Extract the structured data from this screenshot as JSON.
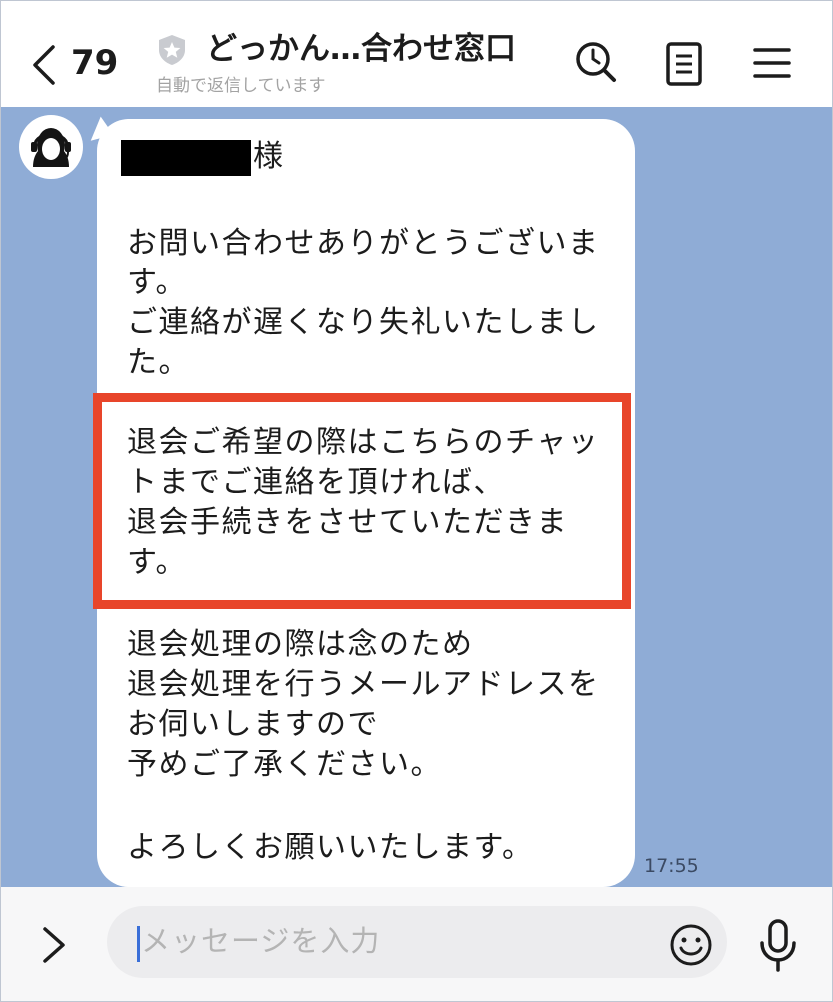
{
  "header": {
    "back_count": "79",
    "title": "どっかん…合わせ窓口",
    "status": "自動で返信しています",
    "icons": [
      "back-chevron-icon",
      "shield-star-icon",
      "search-icon",
      "notes-icon",
      "menu-icon"
    ]
  },
  "message": {
    "recipient_suffix": "様",
    "lines": [
      "お問い合わせありがとうございま",
      "す。",
      "ご連絡が遅くなり失礼いたしまし",
      "た。",
      "退会ご希望の際はこちらのチャッ",
      "トまでご連絡を頂ければ、",
      "退会手続きをさせていただきま",
      "す。",
      "退会処理の際は念のため",
      "退会処理を行うメールアドレスを",
      "お伺いしますので",
      "予めご了承ください。",
      "よろしくお願いいたします。"
    ],
    "timestamp": "17:55",
    "highlight_color": "#e8452a"
  },
  "input": {
    "placeholder": "メッセージを入力",
    "icons": [
      "chevron-right-icon",
      "emoji-icon",
      "microphone-icon"
    ]
  },
  "colors": {
    "chat_background": "#8facd6",
    "bubble": "#ffffff",
    "caret": "#3a6fd8"
  }
}
